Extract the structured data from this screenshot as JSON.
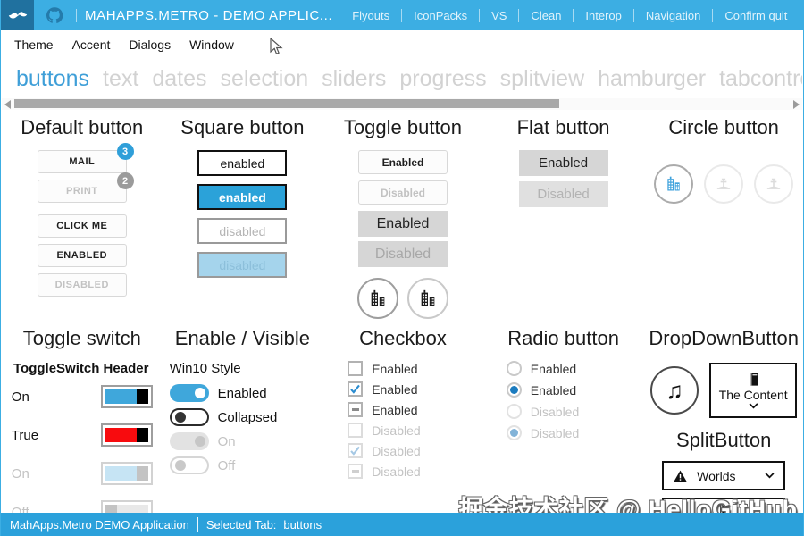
{
  "colors": {
    "accent": "#2f9fd9",
    "titlebar": "#3caee3",
    "logo_bg": "#20719f",
    "statusbar": "#2ba1db",
    "toggle_red": "#f80b0e",
    "toggle_blue": "#3fa7db",
    "disabled_blue": "#a5d4ec"
  },
  "titlebar": {
    "title": "MAHAPPS.METRO - DEMO APPLIC...",
    "menu": [
      "Flyouts",
      "IconPacks",
      "VS",
      "Clean",
      "Interop",
      "Navigation",
      "Confirm quit"
    ],
    "controls": {
      "minimize": "─",
      "maximize": "□",
      "close": "✕"
    }
  },
  "menubar": {
    "items": [
      "Theme",
      "Accent",
      "Dialogs",
      "Window"
    ]
  },
  "tabs": {
    "items": [
      "buttons",
      "text",
      "dates",
      "selection",
      "sliders",
      "progress",
      "splitview",
      "hamburger",
      "tabcontrol"
    ],
    "active": "buttons"
  },
  "default_button": {
    "header": "Default button",
    "mail": "MAIL",
    "mail_badge": "3",
    "print": "PRINT",
    "print_badge": "2",
    "click_me": "CLICK ME",
    "enabled": "ENABLED",
    "disabled": "DISABLED"
  },
  "square_button": {
    "header": "Square button",
    "b1": "enabled",
    "b2": "enabled",
    "b3": "disabled",
    "b4": "disabled"
  },
  "toggle_button": {
    "header": "Toggle button",
    "b1": "Enabled",
    "b2": "Disabled",
    "b3": "Enabled",
    "b4": "Disabled"
  },
  "flat_button": {
    "header": "Flat button",
    "b1": "Enabled",
    "b2": "Disabled"
  },
  "circle_button": {
    "header": "Circle button"
  },
  "toggle_switch": {
    "header": "Toggle switch",
    "subheader": "ToggleSwitch Header",
    "rows": [
      {
        "label": "On"
      },
      {
        "label": "True"
      },
      {
        "label": "On"
      },
      {
        "label": "Off"
      }
    ]
  },
  "enable_visible": {
    "header": "Enable / Visible",
    "subheader": "Win10 Style",
    "rows": [
      {
        "label": "Enabled"
      },
      {
        "label": "Collapsed"
      },
      {
        "label": "On"
      },
      {
        "label": "Off"
      }
    ]
  },
  "checkbox": {
    "header": "Checkbox",
    "items": [
      "Enabled",
      "Enabled",
      "Enabled",
      "Disabled",
      "Disabled",
      "Disabled"
    ]
  },
  "radio": {
    "header": "Radio button",
    "items": [
      "Enabled",
      "Enabled",
      "Disabled",
      "Disabled"
    ]
  },
  "dropdown_button": {
    "header": "DropDownButton",
    "content_label": "The Content",
    "music_icon": "♫"
  },
  "split_button": {
    "header": "SplitButton",
    "label": "Worlds"
  },
  "statusbar": {
    "app": "MahApps.Metro DEMO Application",
    "selected_label": "Selected Tab:",
    "selected_value": "buttons"
  },
  "watermark": "掘金技术社区 @ HelloGitHub"
}
